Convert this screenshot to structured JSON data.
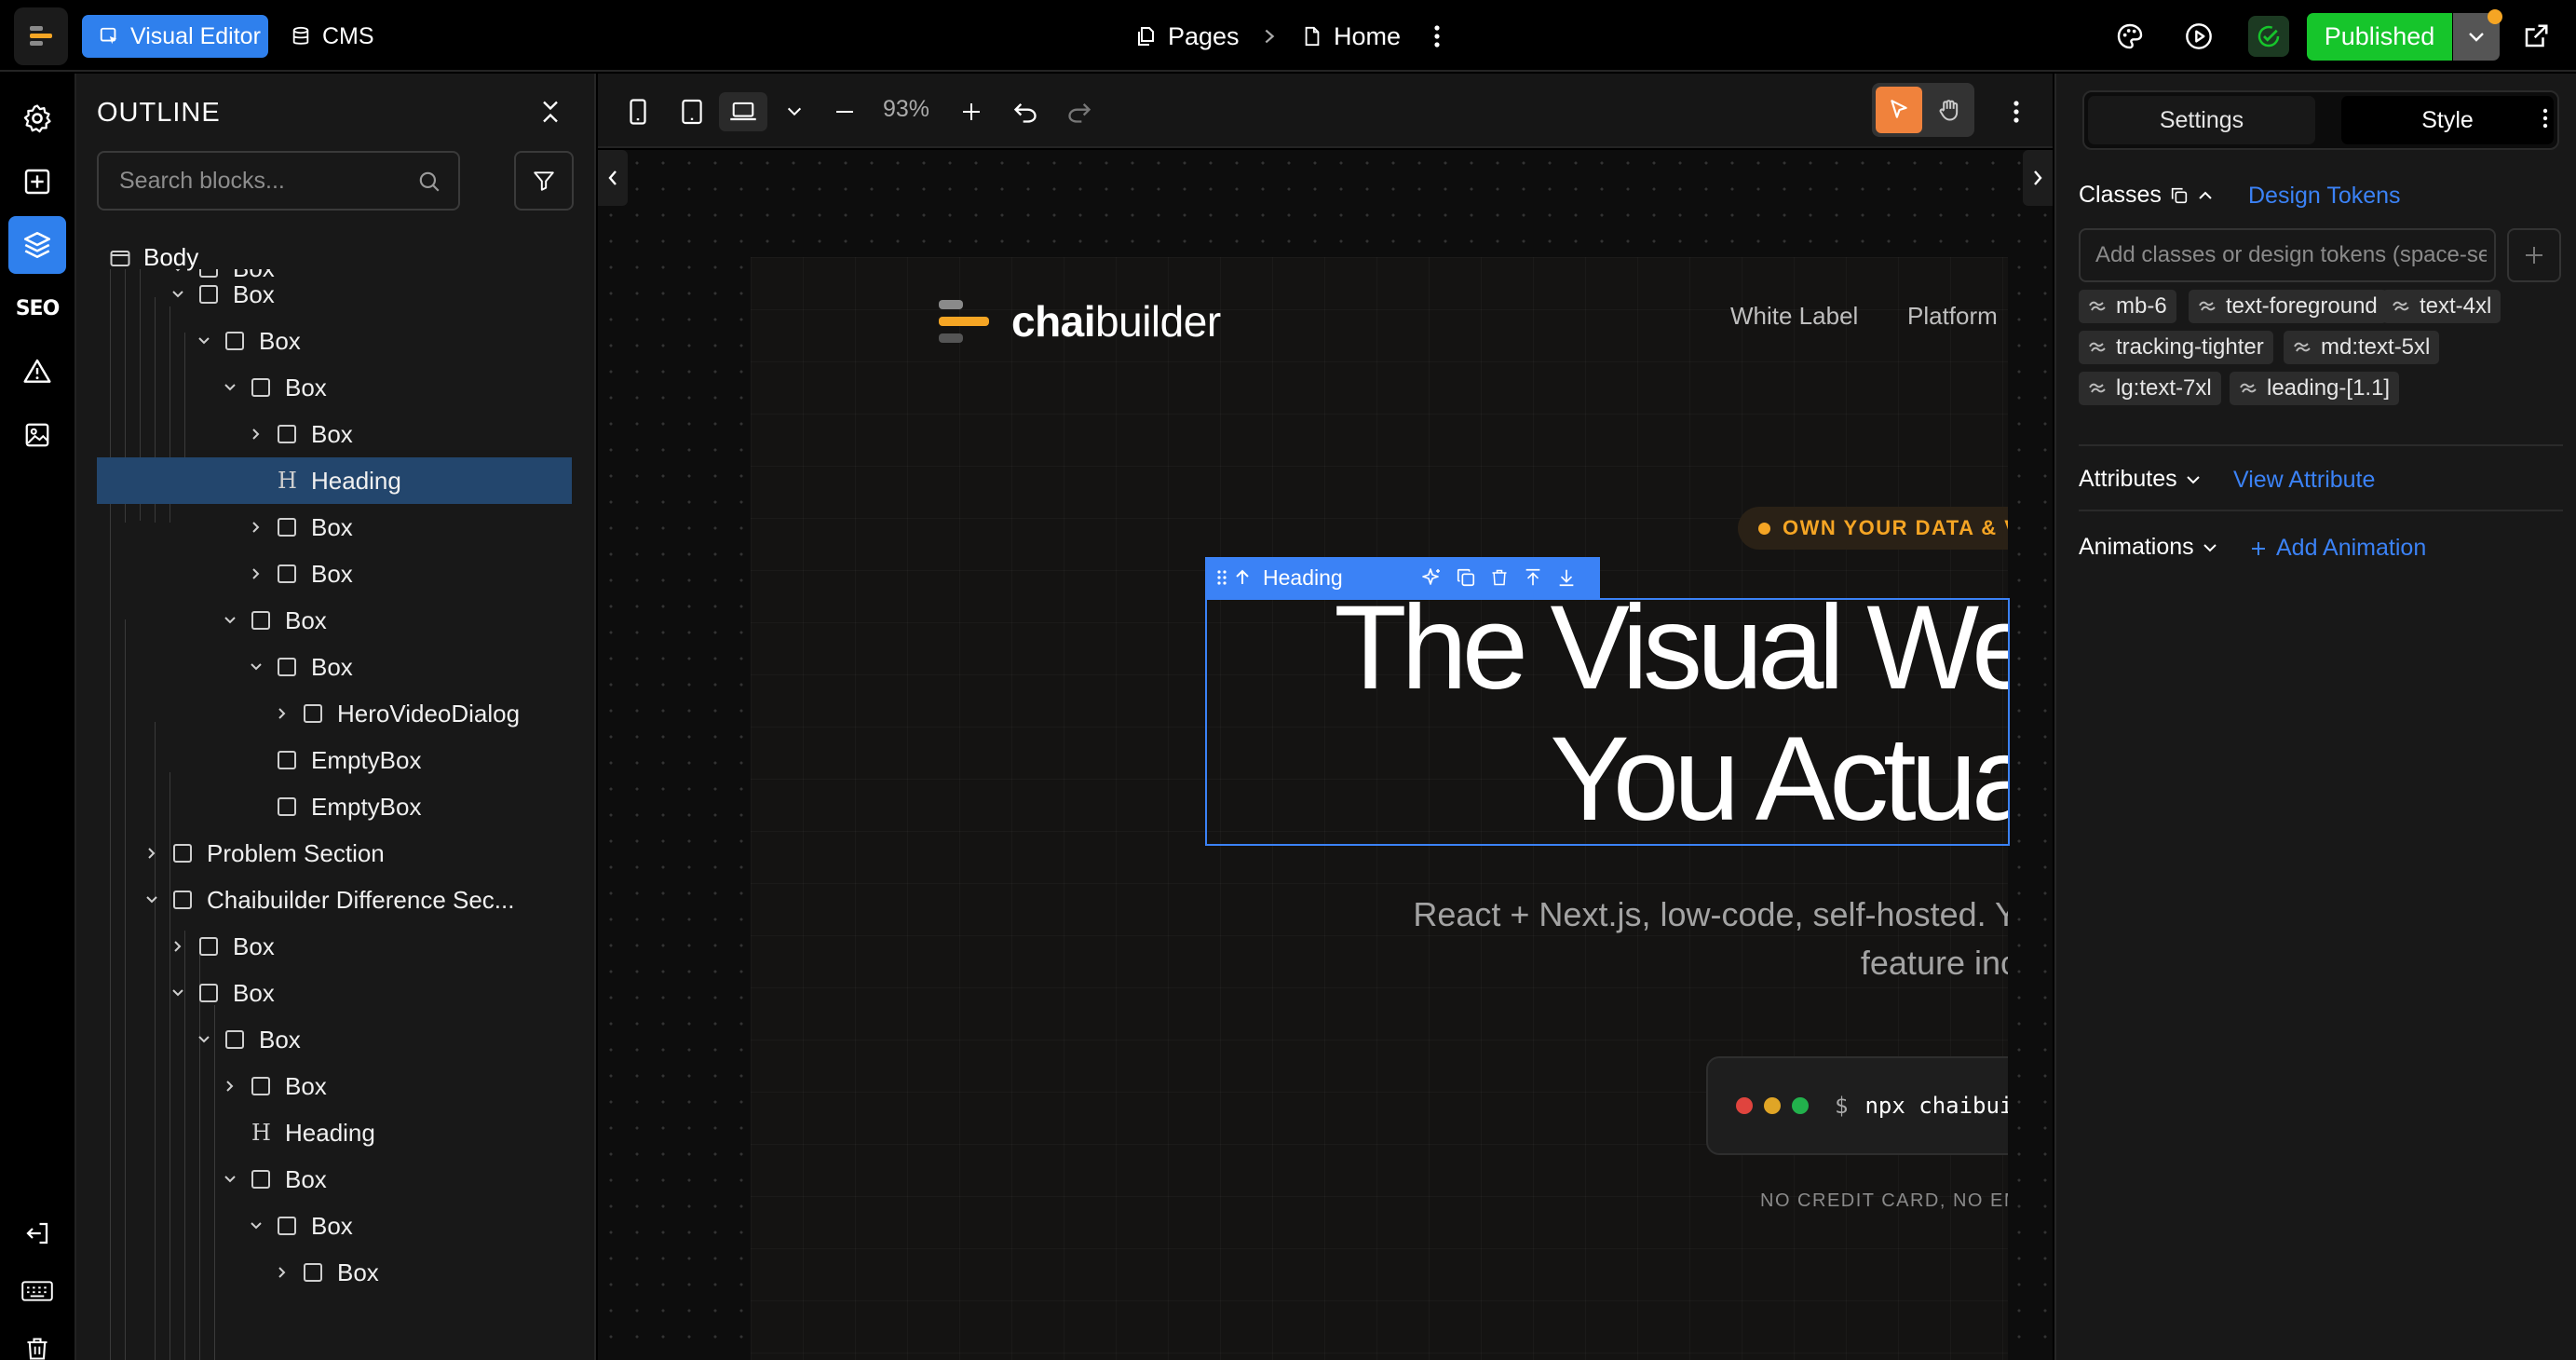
{
  "topbar": {
    "visual_editor_label": "Visual Editor",
    "cms_label": "CMS",
    "pages_label": "Pages",
    "current_page": "Home",
    "publish_label": "Published"
  },
  "rail": {
    "seo_label": "SEO"
  },
  "outline": {
    "title": "OUTLINE",
    "search_placeholder": "Search blocks...",
    "root_label": "Body",
    "rows": [
      {
        "label": "Box"
      },
      {
        "label": "Box"
      },
      {
        "label": "Box"
      },
      {
        "label": "Box"
      },
      {
        "label": "Box"
      },
      {
        "label": "Heading"
      },
      {
        "label": "Box"
      },
      {
        "label": "Box"
      },
      {
        "label": "Box"
      },
      {
        "label": "Box"
      },
      {
        "label": "HeroVideoDialog"
      },
      {
        "label": "EmptyBox"
      },
      {
        "label": "EmptyBox"
      },
      {
        "label": "Problem Section"
      },
      {
        "label": "Chaibuilder Difference Sec..."
      },
      {
        "label": "Box"
      },
      {
        "label": "Box"
      },
      {
        "label": "Box"
      },
      {
        "label": "Box"
      },
      {
        "label": "Heading"
      },
      {
        "label": "Box"
      },
      {
        "label": "Box"
      },
      {
        "label": "Box"
      }
    ]
  },
  "canvas": {
    "zoom": "93%",
    "page": {
      "logo_bold": "chai",
      "logo_rest": "builder",
      "nav": [
        "White Label",
        "Platform"
      ],
      "badge": "OWN YOUR DATA & V",
      "heading_lines": [
        "The Visual We",
        "You Actua"
      ],
      "sub_lines": [
        "React + Next.js, low-code, self-hosted. Y",
        "feature inc"
      ],
      "terminal_dollar": "$",
      "terminal_cmd": "npx chaibuilde",
      "note": "NO CREDIT CARD, NO EM"
    },
    "selection": {
      "label": "Heading"
    }
  },
  "panel": {
    "tab_settings": "Settings",
    "tab_style": "Style",
    "classes_label": "Classes",
    "design_tokens_label": "Design Tokens",
    "classes_placeholder": "Add classes or design tokens (space-se",
    "chips": [
      "mb-6",
      "text-foreground",
      "text-4xl",
      "tracking-tighter",
      "md:text-5xl",
      "lg:text-7xl",
      "leading-[1.1]"
    ],
    "attributes_label": "Attributes",
    "view_attribute_label": "View Attribute",
    "animations_label": "Animations",
    "add_animation_label": "Add Animation"
  },
  "colors": {
    "accent": "#2f80ed",
    "publish": "#16c52b",
    "brand_orange": "#f5a524",
    "selection": "#3b82f6"
  }
}
